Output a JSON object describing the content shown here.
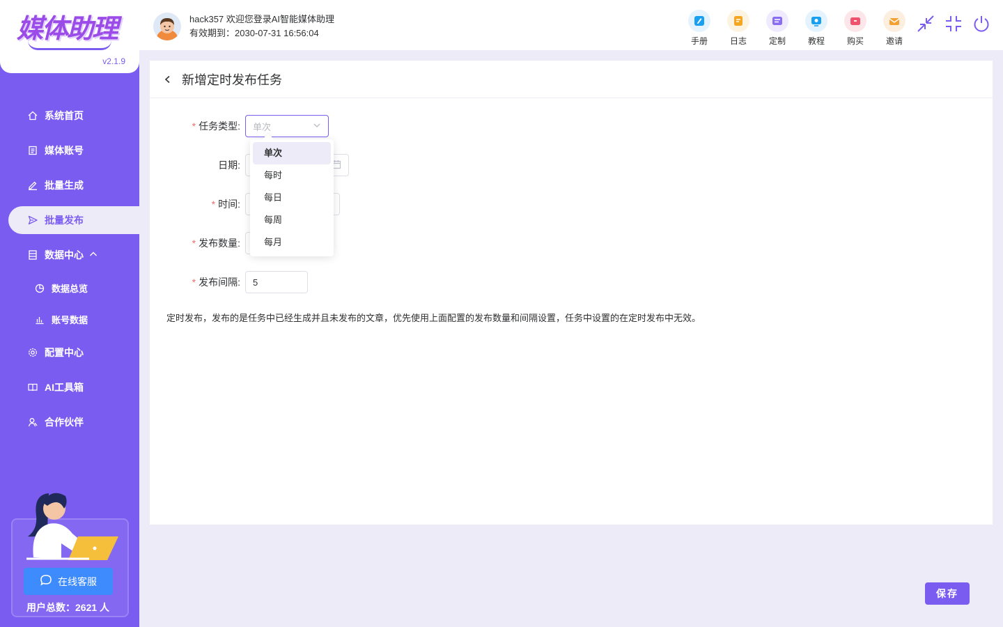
{
  "app": {
    "logo_text": "媒体助理",
    "version": "v2.1.9"
  },
  "sidebar": {
    "items": [
      {
        "label": "系统首页",
        "icon": "home-icon"
      },
      {
        "label": "媒体账号",
        "icon": "account-icon"
      },
      {
        "label": "批量生成",
        "icon": "edit-icon"
      },
      {
        "label": "批量发布",
        "icon": "send-icon"
      },
      {
        "label": "数据中心",
        "icon": "data-icon"
      },
      {
        "label": "数据总览",
        "icon": "pie-chart-icon"
      },
      {
        "label": "账号数据",
        "icon": "bar-chart-icon"
      },
      {
        "label": "配置中心",
        "icon": "gear-icon"
      },
      {
        "label": "AI工具箱",
        "icon": "book-icon"
      },
      {
        "label": "合作伙伴",
        "icon": "partner-icon"
      }
    ],
    "kefu_label": "在线客服",
    "user_total": "用户总数：2621 人"
  },
  "header": {
    "welcome": "hack357 欢迎您登录AI智能媒体助理",
    "expiry": "有效期到：2030-07-31 16:56:04",
    "tools": [
      {
        "label": "手册",
        "color": "#1aa0f0"
      },
      {
        "label": "日志",
        "color": "#f5a623"
      },
      {
        "label": "定制",
        "color": "#8a6ef2"
      },
      {
        "label": "教程",
        "color": "#1aa0f0"
      },
      {
        "label": "购买",
        "color": "#f0516e"
      },
      {
        "label": "邀请",
        "color": "#f5a033"
      }
    ]
  },
  "page": {
    "title": "新增定时发布任务",
    "labels": {
      "task_type": "任务类型:",
      "date": "日期:",
      "time": "时间:",
      "count": "发布数量:",
      "interval": "发布间隔:"
    },
    "task_type_placeholder": "单次",
    "interval_value": "5",
    "note": "定时发布，发布的是任务中已经生成并且未发布的文章，优先使用上面配置的发布数量和间隔设置，任务中设置的在定时发布中无效。",
    "dropdown_options": [
      "单次",
      "每时",
      "每日",
      "每周",
      "每月"
    ],
    "save_label": "保存"
  },
  "colors": {
    "accent": "#7b5cf0",
    "bg": "#ecebf7",
    "required": "#f56c6c"
  }
}
